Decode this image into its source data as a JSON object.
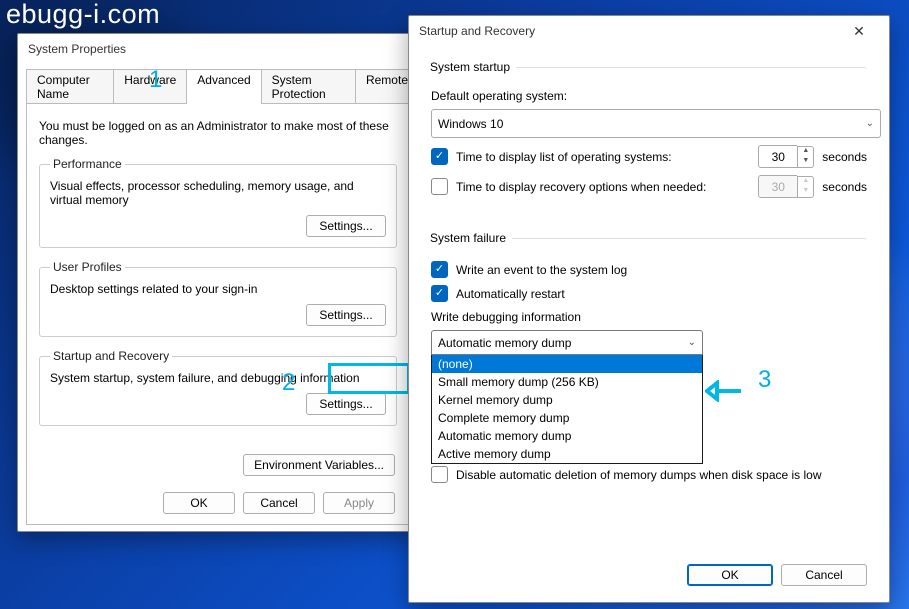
{
  "watermark": "ebugg-i.com",
  "sysprop": {
    "title": "System Properties",
    "tabs": [
      "Computer Name",
      "Hardware",
      "Advanced",
      "System Protection",
      "Remote"
    ],
    "active_tab": "Advanced",
    "admin_note": "You must be logged on as an Administrator to make most of these changes.",
    "perf": {
      "legend": "Performance",
      "desc": "Visual effects, processor scheduling, memory usage, and virtual memory",
      "btn": "Settings..."
    },
    "profiles": {
      "legend": "User Profiles",
      "desc": "Desktop settings related to your sign-in",
      "btn": "Settings..."
    },
    "startup": {
      "legend": "Startup and Recovery",
      "desc": "System startup, system failure, and debugging information",
      "btn": "Settings..."
    },
    "env_btn": "Environment Variables...",
    "ok": "OK",
    "cancel": "Cancel",
    "apply": "Apply"
  },
  "sr": {
    "title": "Startup and Recovery",
    "startup_h": "System startup",
    "default_os_label": "Default operating system:",
    "default_os": "Windows 10",
    "os_list_cb": "Time to display list of operating systems:",
    "os_list_secs": "30",
    "recovery_cb": "Time to display recovery options when needed:",
    "recovery_secs": "30",
    "seconds": "seconds",
    "failure_h": "System failure",
    "write_event": "Write an event to the system log",
    "auto_restart": "Automatically restart",
    "wdi": "Write debugging information",
    "dump_selected": "Automatic memory dump",
    "dump_options": [
      "(none)",
      "Small memory dump (256 KB)",
      "Kernel memory dump",
      "Complete memory dump",
      "Automatic memory dump",
      "Active memory dump"
    ],
    "disable_delete": "Disable automatic deletion of memory dumps when disk space is low",
    "ok": "OK",
    "cancel": "Cancel"
  },
  "callouts": {
    "one": "1",
    "two": "2",
    "three": "3"
  }
}
